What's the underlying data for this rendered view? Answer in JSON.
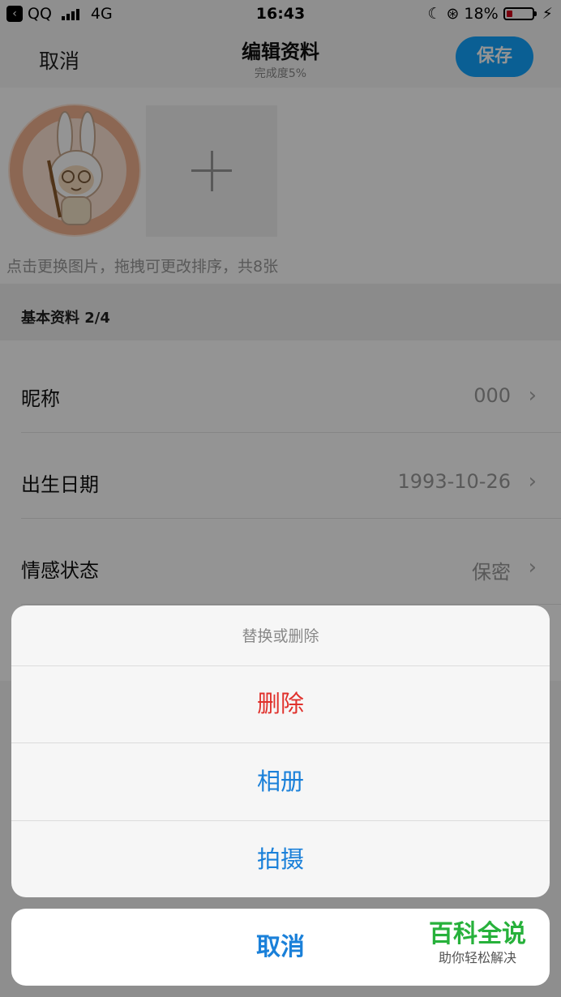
{
  "status_bar": {
    "back_app": "QQ",
    "network": "4G",
    "time": "16:43",
    "battery": "18%"
  },
  "nav": {
    "cancel": "取消",
    "title": "编辑资料",
    "subtitle": "完成度5%",
    "save": "保存"
  },
  "photos": {
    "hint": "点击更换图片，拖拽可更改排序，共8张"
  },
  "section": {
    "header": "基本资料 2/4"
  },
  "rows": [
    {
      "label": "昵称",
      "value": "000"
    },
    {
      "label": "出生日期",
      "value": "1993-10-26"
    },
    {
      "label": "情感状态",
      "value": "保密"
    }
  ],
  "action_sheet": {
    "title": "替换或删除",
    "delete": "删除",
    "album": "相册",
    "camera": "拍摄",
    "cancel": "取消"
  },
  "watermark": {
    "title": "百科全说",
    "subtitle": "助你轻松解决"
  },
  "colors": {
    "accent_blue": "#1a80d9",
    "save_blue": "#12a4ff",
    "danger_red": "#e0312c",
    "watermark_green": "#27b13b"
  }
}
